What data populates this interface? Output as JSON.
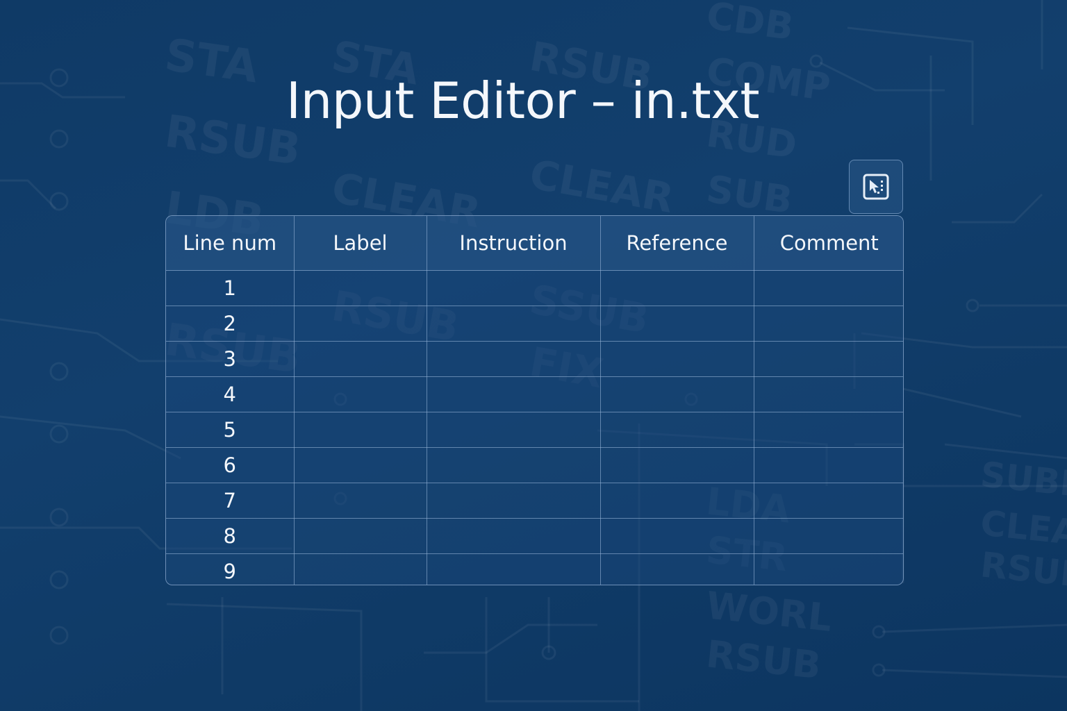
{
  "title": "Input Editor – in.txt",
  "toolbar": {
    "select_icon": "selection-cursor-icon"
  },
  "table": {
    "columns": [
      "Line num",
      "Label",
      "Instruction",
      "Reference",
      "Comment"
    ],
    "rows": [
      {
        "line": "1",
        "label": "",
        "instruction": "",
        "reference": "",
        "comment": ""
      },
      {
        "line": "2",
        "label": "",
        "instruction": "",
        "reference": "",
        "comment": ""
      },
      {
        "line": "3",
        "label": "",
        "instruction": "",
        "reference": "",
        "comment": ""
      },
      {
        "line": "4",
        "label": "",
        "instruction": "",
        "reference": "",
        "comment": ""
      },
      {
        "line": "5",
        "label": "",
        "instruction": "",
        "reference": "",
        "comment": ""
      },
      {
        "line": "6",
        "label": "",
        "instruction": "",
        "reference": "",
        "comment": ""
      },
      {
        "line": "7",
        "label": "",
        "instruction": "",
        "reference": "",
        "comment": ""
      },
      {
        "line": "8",
        "label": "",
        "instruction": "",
        "reference": "",
        "comment": ""
      },
      {
        "line": "9",
        "label": "",
        "instruction": "",
        "reference": "",
        "comment": ""
      }
    ]
  },
  "background": {
    "words": [
      "STA",
      "RSUB",
      "LDB",
      "SUB",
      "CLEAR",
      "COMP",
      "RSUB",
      "STA",
      "LDA",
      "STR",
      "WORL",
      "SUBD",
      "CLEAR",
      "RSUB",
      "FIX",
      "SSUB",
      "CDB",
      "RUD"
    ]
  },
  "colors": {
    "background": "#0f3a66",
    "text": "#f4f7fb",
    "grid": "#96b4d7"
  }
}
